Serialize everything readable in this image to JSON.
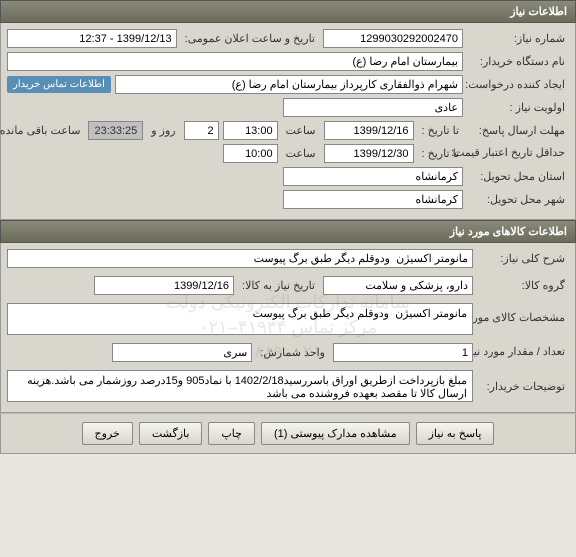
{
  "section1": {
    "title": "اطلاعات نیاز",
    "req_no_label": "شماره نیاز:",
    "req_no": "1299030292002470",
    "announce_label": "تاریخ و ساعت اعلان عمومی:",
    "announce_value": "1399/12/13 - 12:37",
    "device_label": "نام دستگاه خریدار:",
    "device_value": "بیمارستان امام رضا (ع)",
    "creator_label": "ایجاد کننده درخواست:",
    "creator_value": "شهرام ذوالفقاری کارپرداز بیمارستان امام رضا (ع)",
    "contact_link": "اطلاعات تماس خریدار",
    "priority_label": "اولویت نیاز :",
    "priority_value": "عادی",
    "deadline_label": "مهلت ارسال پاسخ:",
    "to_date_label1": "تا تاریخ :",
    "deadline_date": "1399/12/16",
    "time_label": "ساعت",
    "deadline_time": "13:00",
    "days_value": "2",
    "days_label": "روز و",
    "countdown": "23:33:25",
    "remaining_label": "ساعت باقی مانده",
    "min_credit_label": "حداقل تاریخ اعتبار قیمت:",
    "to_date_label2": "تا تاریخ :",
    "credit_date": "1399/12/30",
    "credit_time": "10:00",
    "province_label": "استان محل تحویل:",
    "province_value": "کرمانشاه",
    "city_label": "شهر محل تحویل:",
    "city_value": "کرمانشاه"
  },
  "section2": {
    "title": "اطلاعات کالاهای مورد نیاز",
    "desc_label": "شرح کلی نیاز:",
    "desc_value": "مانومتر اکسیژن  ودوقلم دیگر طبق برگ پیوست",
    "group_label": "گروه کالا:",
    "group_value": "دارو، پزشکی و سلامت",
    "need_date_label": "تاریخ نیاز به کالا:",
    "need_date": "1399/12/16",
    "spec_label": "مشخصات کالای مورد نیاز:",
    "spec_value": "مانومتر اکسیژن  ودوقلم دیگر طبق برگ پیوست",
    "qty_label": "تعداد / مقدار مورد نیاز:",
    "qty_value": "1",
    "unit_label": "واحد شمارش:",
    "unit_value": "سری",
    "buyer_notes_label": "توضیحات خریدار:",
    "buyer_notes": "مبلغ بازپرداخت ازطریق اوراق باسررسید1402/2/18 با نماد905 و15درصد روزشمار می باشد.هزینه ارسال کالا تا مقصد بعهده فروشنده می باشد",
    "watermark_line1": "سامانه تدارکات الکترونیکی دولت",
    "watermark_line2": "مرکز تماس ۴۱۹۳۴–۰۲۱",
    "watermark_line3": "۰۲۱–۸۸۹"
  },
  "footer": {
    "reply": "پاسخ به نیاز",
    "attachments": "مشاهده مدارک پیوستی (1)",
    "print": "چاپ",
    "back": "بازگشت",
    "exit": "خروج"
  }
}
